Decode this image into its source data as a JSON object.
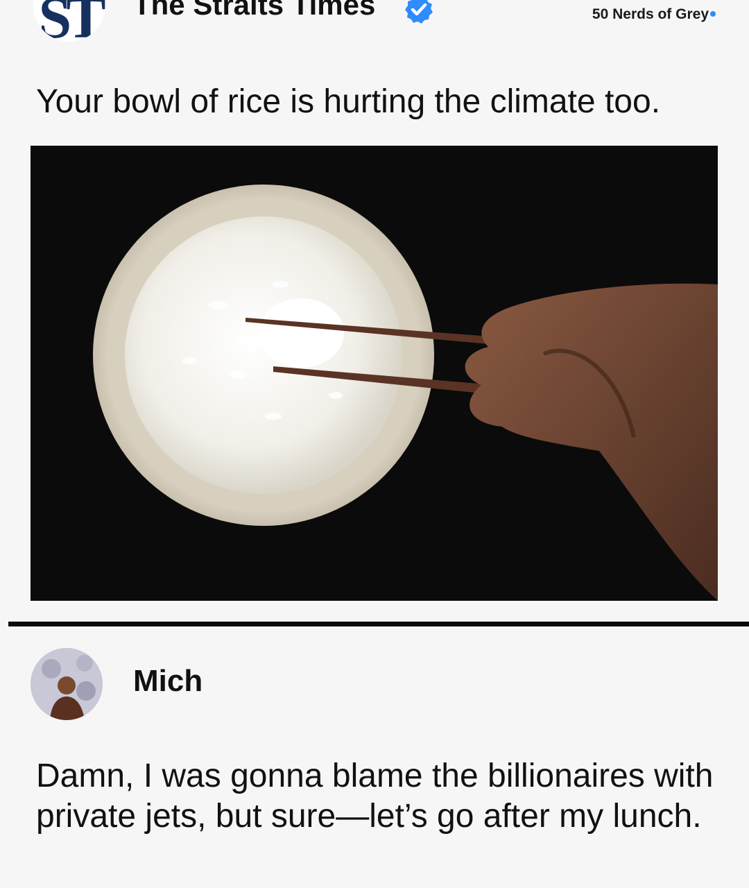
{
  "post": {
    "account_name": "The Straits Times",
    "logo_text": "ST",
    "watermark": "50 Nerds of Grey",
    "headline": "Your bowl of rice is hurting the climate too.",
    "image_icon": "photo-rice-bowl-chopsticks"
  },
  "reply": {
    "author": "Mich",
    "text": "Damn, I was gonna blame the billionaires with private jets, but sure—let’s go after my lunch."
  },
  "colors": {
    "verified_badge": "#2f8cff",
    "logo": "#16305f",
    "divider": "#0a0a0a",
    "background": "#f6f6f6"
  }
}
